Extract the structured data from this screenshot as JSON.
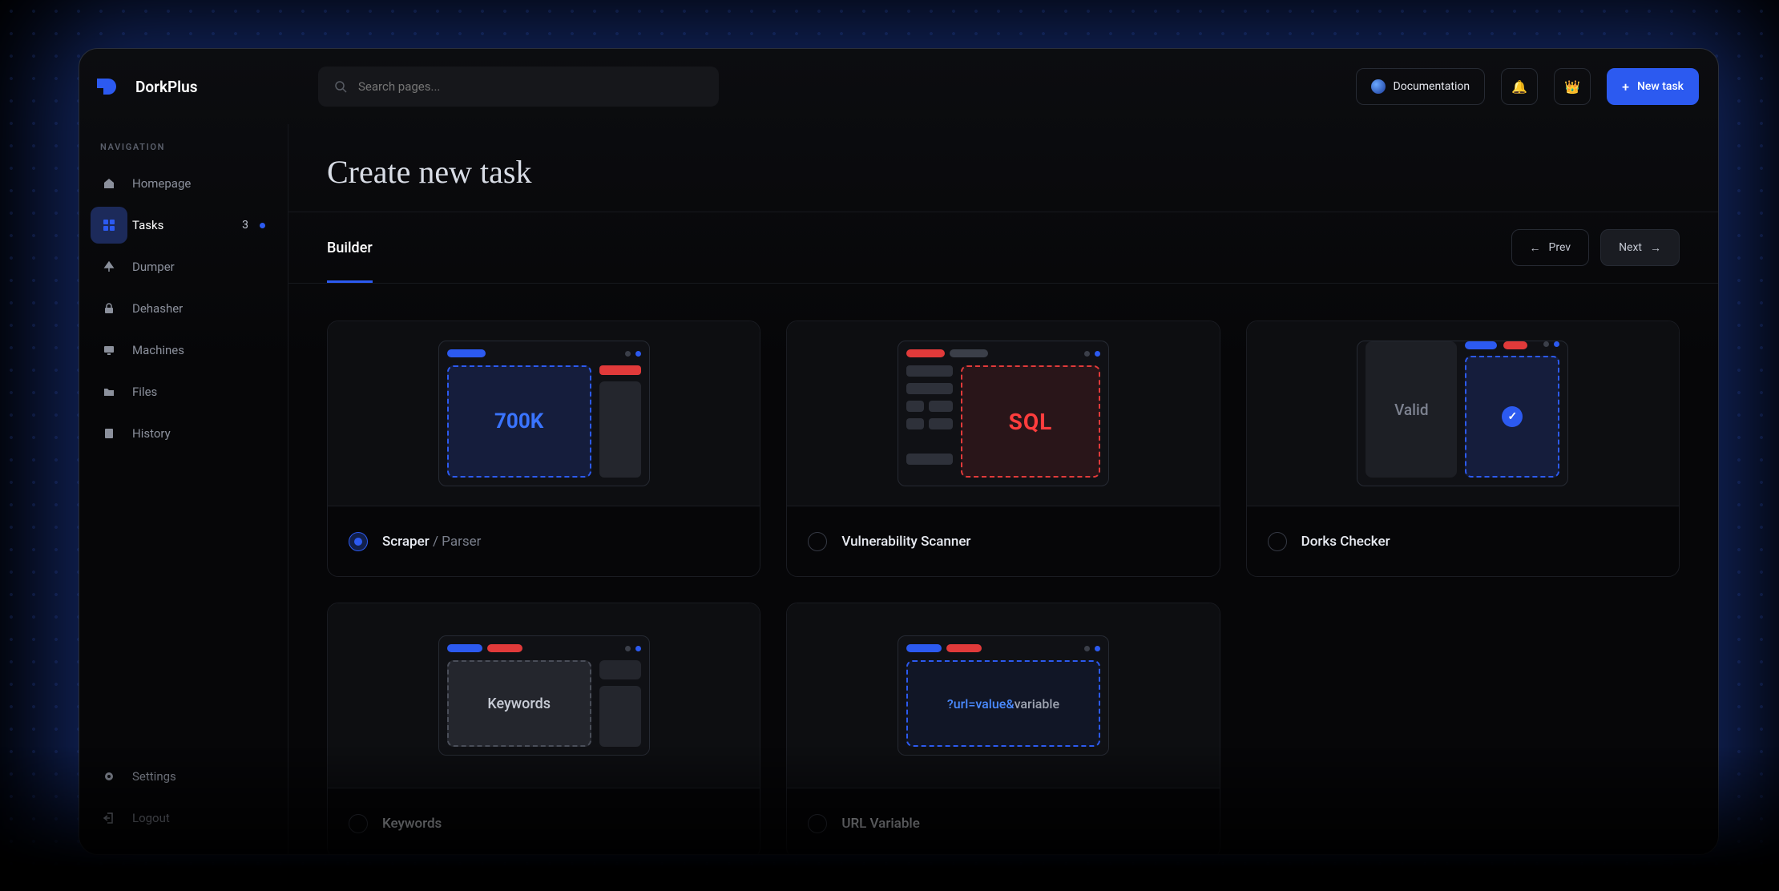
{
  "brand": {
    "name": "DorkPlus"
  },
  "search": {
    "placeholder": "Search pages..."
  },
  "topbar": {
    "documentation": "Documentation",
    "newTask": "New task"
  },
  "sidebar": {
    "label": "NAVIGATION",
    "items": [
      {
        "key": "homepage",
        "label": "Homepage"
      },
      {
        "key": "tasks",
        "label": "Tasks",
        "count": "3",
        "active": true
      },
      {
        "key": "dumper",
        "label": "Dumper"
      },
      {
        "key": "dehasher",
        "label": "Dehasher"
      },
      {
        "key": "machines",
        "label": "Machines"
      },
      {
        "key": "files",
        "label": "Files"
      },
      {
        "key": "history",
        "label": "History"
      }
    ],
    "footer": [
      {
        "key": "settings",
        "label": "Settings"
      },
      {
        "key": "logout",
        "label": "Logout"
      }
    ]
  },
  "page": {
    "title": "Create new task",
    "tab": "Builder",
    "prev": "Prev",
    "next": "Next"
  },
  "cards": {
    "scraper": {
      "title": "Scraper",
      "sub": "/ Parser",
      "metric": "700K"
    },
    "vuln": {
      "title": "Vulnerability Scanner",
      "badge": "SQL"
    },
    "dorks": {
      "title": "Dorks Checker",
      "valid": "Valid"
    },
    "keywords": {
      "title": "Keywords",
      "chip": "Keywords"
    },
    "urlvar": {
      "title": "URL Variable",
      "prefix": "?url=value&",
      "suffix": "variable"
    }
  }
}
